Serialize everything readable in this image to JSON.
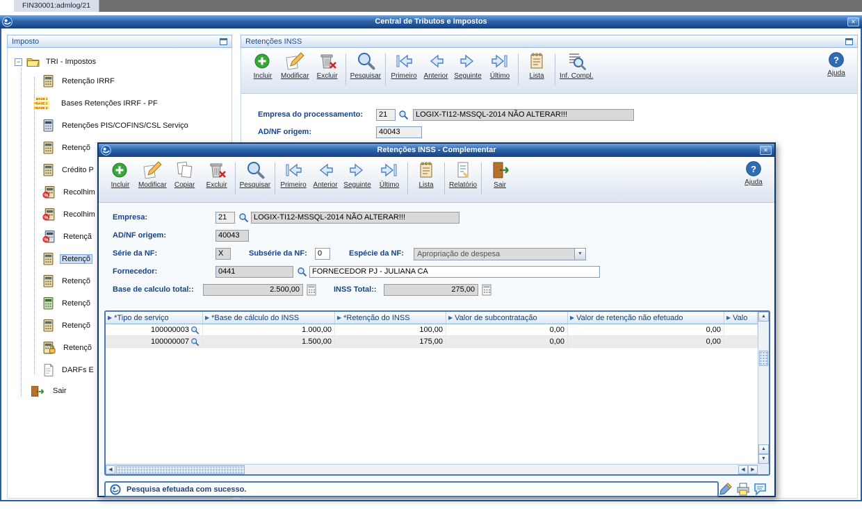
{
  "glyphs": {
    "close": "✕",
    "minus": "−",
    "sort": "▶",
    "up": "▲",
    "down": "▼",
    "left": "◀",
    "right": "▶",
    "help": "?",
    "percent": "%"
  },
  "colors": {
    "titlebar_blue": "#2a61a8",
    "accent_blue": "#15428b",
    "selection": "#cadef7",
    "grid_border": "#4a78b5"
  },
  "shell": {
    "tab": "FIN30001:admlog/21",
    "title": "Central de Tributos e Impostos"
  },
  "sidebar": {
    "header": "Imposto",
    "root_label": "TRI - Impostos",
    "items": [
      {
        "label": "Retenção IRRF",
        "icon": "calculator-icon"
      },
      {
        "label": "Bases Retenções IRRF - PF",
        "icon": "bases-badge-icon",
        "badge": [
          "BASE 1",
          "+BASE 2",
          "+BASE 4"
        ]
      },
      {
        "label": "Retenções PIS/COFINS/CSL Serviço",
        "icon": "calculator-icon"
      },
      {
        "label": "Retençõ",
        "icon": "calculator-icon"
      },
      {
        "label": "Crédito P",
        "icon": "calculator-icon"
      },
      {
        "label": "Recolhim",
        "icon": "calculator-percent-icon"
      },
      {
        "label": "Recolhim",
        "icon": "calculator-percent-icon"
      },
      {
        "label": "Retençã",
        "icon": "calculator-percent-icon"
      },
      {
        "label": "Retençõ",
        "icon": "calculator-icon",
        "selected": true
      },
      {
        "label": "Retençõ",
        "icon": "calculator-icon"
      },
      {
        "label": "Retençõ",
        "icon": "calculator-green-icon"
      },
      {
        "label": "Retençõ",
        "icon": "calculator-icon"
      },
      {
        "label": "Retençõ",
        "icon": "calculator-lock-icon"
      },
      {
        "label": "DARFs E",
        "icon": "document-icon"
      },
      {
        "label": "Sair",
        "icon": "exit-door-icon"
      }
    ]
  },
  "main": {
    "header": "Retenções INSS",
    "help_label": "Ajuda",
    "toolbar": [
      {
        "label": "Incluir",
        "icon": "add-icon"
      },
      {
        "label": "Modificar",
        "icon": "edit-icon"
      },
      {
        "label": "Excluir",
        "icon": "delete-icon"
      },
      {
        "label": "Pesquisar",
        "icon": "search-icon"
      },
      {
        "label": "Primeiro",
        "icon": "first-icon"
      },
      {
        "label": "Anterior",
        "icon": "previous-icon"
      },
      {
        "label": "Seguinte",
        "icon": "next-icon"
      },
      {
        "label": "Último",
        "icon": "last-icon"
      },
      {
        "label": "Lista",
        "icon": "list-icon"
      },
      {
        "label": "Inf. Compl.",
        "icon": "info-search-icon"
      }
    ],
    "fields": {
      "empresa_label": "Empresa do processamento:",
      "empresa_code": "21",
      "empresa_name": "LOGIX-TI12-MSSQL-2014 NÃO ALTERAR!!!",
      "adnf_label": "AD/NF origem:",
      "adnf_value": "40043"
    }
  },
  "modal": {
    "title": "Retenções INSS - Complementar",
    "help_label": "Ajuda",
    "toolbar": [
      {
        "label": "Incluir",
        "icon": "add-icon"
      },
      {
        "label": "Modificar",
        "icon": "edit-icon"
      },
      {
        "label": "Copiar",
        "icon": "copy-icon"
      },
      {
        "label": "Excluir",
        "icon": "delete-icon"
      },
      {
        "label": "Pesquisar",
        "icon": "search-icon"
      },
      {
        "label": "Primeiro",
        "icon": "first-icon"
      },
      {
        "label": "Anterior",
        "icon": "previous-icon"
      },
      {
        "label": "Seguinte",
        "icon": "next-icon"
      },
      {
        "label": "Último",
        "icon": "last-icon"
      },
      {
        "label": "Lista",
        "icon": "list-icon"
      },
      {
        "label": "Relatório",
        "icon": "report-icon"
      },
      {
        "label": "Sair",
        "icon": "exit-icon"
      }
    ],
    "fields": {
      "empresa_label": "Empresa:",
      "empresa_code": "21",
      "empresa_name": "LOGIX-TI12-MSSQL-2014 NÃO ALTERAR!!!",
      "adnf_label": "AD/NF origem:",
      "adnf_value": "40043",
      "serie_label": "Série da NF:",
      "serie_value": "X",
      "subserie_label": "Subsérie da NF:",
      "subserie_value": "0",
      "especie_label": "Espécie da NF:",
      "especie_value": "Apropriação de despesa",
      "fornecedor_label": "Fornecedor:",
      "fornecedor_code": "0441",
      "fornecedor_name": "FORNECEDOR PJ - JULIANA CA",
      "base_label": "Base de calculo total::",
      "base_value": "2.500,00",
      "inss_label": "INSS Total::",
      "inss_value": "275,00"
    },
    "grid": {
      "columns": [
        "*Tipo de serviço",
        "*Base de cálculo do INSS",
        "*Retenção do INSS",
        "Valor de subcontratação",
        "Valor de retenção não efetuado",
        "Valo"
      ],
      "rows": [
        [
          "100000003",
          "1.000,00",
          "100,00",
          "0,00",
          "0,00",
          ""
        ],
        [
          "100000007",
          "1.500,00",
          "175,00",
          "0,00",
          "0,00",
          ""
        ]
      ]
    },
    "status_text": "Pesquisa efetuada com sucesso."
  }
}
